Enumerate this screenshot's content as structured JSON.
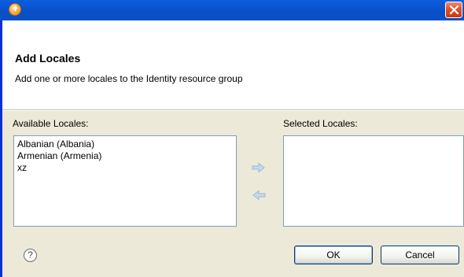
{
  "window": {
    "title_icon": "app-icon",
    "close_icon": "close-icon"
  },
  "header": {
    "title": "Add Locales",
    "description": "Add one or more locales to the Identity resource group"
  },
  "available": {
    "label": "Available Locales:",
    "items": [
      "Albanian (Albania)",
      "Armenian (Armenia)",
      "xz"
    ]
  },
  "selected": {
    "label": "Selected Locales:",
    "items": []
  },
  "controls": {
    "add_icon": "arrow-right-icon",
    "remove_icon": "arrow-left-icon",
    "help_glyph": "?"
  },
  "buttons": {
    "ok": "OK",
    "cancel": "Cancel"
  },
  "colors": {
    "titlebar": "#0a55d2",
    "dialog_bg": "#ece9d8",
    "list_border": "#7f9db9",
    "close_button": "#dc4d25"
  }
}
